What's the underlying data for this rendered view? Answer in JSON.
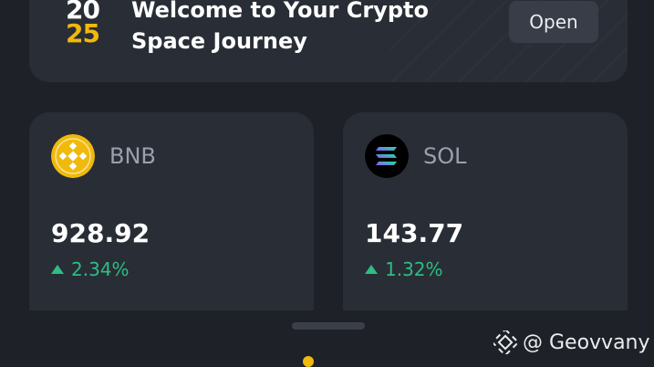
{
  "banner": {
    "logo_top": "20",
    "logo_bottom": "25",
    "title": "Welcome to Your Crypto Space Journey",
    "open_label": "Open"
  },
  "cards": [
    {
      "symbol": "BNB",
      "price": "928.92",
      "change": "2.34%",
      "icon": "bnb-coin-icon",
      "icon_color": "#f0b90b"
    },
    {
      "symbol": "SOL",
      "price": "143.77",
      "change": "1.32%",
      "icon": "sol-coin-icon",
      "icon_color": "#000000"
    }
  ],
  "colors": {
    "background": "#1e2128",
    "card": "#292d36",
    "accent": "#f0b90b",
    "positive": "#2ebd85"
  },
  "watermark": {
    "text": "@ Geovvany",
    "icon": "binance-square-icon"
  }
}
